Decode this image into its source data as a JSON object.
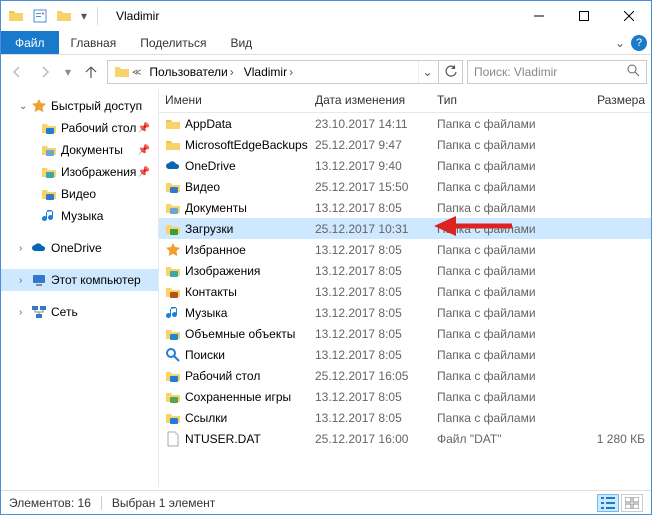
{
  "window": {
    "title": "Vladimir"
  },
  "ribbon": {
    "file": "Файл",
    "tabs": [
      "Главная",
      "Поделиться",
      "Вид"
    ]
  },
  "breadcrumb": {
    "segments": [
      "Пользователи",
      "Vladimir"
    ]
  },
  "search": {
    "placeholder": "Поиск: Vladimir"
  },
  "columns": {
    "name": "Имени",
    "date": "Дата изменения",
    "type": "Тип",
    "size": "Размера"
  },
  "nav": {
    "quick": "Быстрый доступ",
    "quick_items": [
      {
        "label": "Рабочий стол",
        "icon": "desktop",
        "pinned": true
      },
      {
        "label": "Документы",
        "icon": "docs",
        "pinned": true
      },
      {
        "label": "Изображения",
        "icon": "pics",
        "pinned": true
      },
      {
        "label": "Видео",
        "icon": "video",
        "pinned": false
      },
      {
        "label": "Музыка",
        "icon": "music",
        "pinned": false
      }
    ],
    "onedrive": "OneDrive",
    "thispc": "Этот компьютер",
    "network": "Сеть"
  },
  "files": [
    {
      "name": "AppData",
      "date": "23.10.2017 14:11",
      "type": "Папка с файлами",
      "size": "",
      "icon": "folder"
    },
    {
      "name": "MicrosoftEdgeBackups",
      "date": "25.12.2017 9:47",
      "type": "Папка с файлами",
      "size": "",
      "icon": "folder"
    },
    {
      "name": "OneDrive",
      "date": "13.12.2017 9:40",
      "type": "Папка с файлами",
      "size": "",
      "icon": "onedrive"
    },
    {
      "name": "Видео",
      "date": "25.12.2017 15:50",
      "type": "Папка с файлами",
      "size": "",
      "icon": "video"
    },
    {
      "name": "Документы",
      "date": "13.12.2017 8:05",
      "type": "Папка с файлами",
      "size": "",
      "icon": "docs"
    },
    {
      "name": "Загрузки",
      "date": "25.12.2017 10:31",
      "type": "Папка с файлами",
      "size": "",
      "icon": "downloads",
      "selected": true
    },
    {
      "name": "Избранное",
      "date": "13.12.2017 8:05",
      "type": "Папка с файлами",
      "size": "",
      "icon": "star"
    },
    {
      "name": "Изображения",
      "date": "13.12.2017 8:05",
      "type": "Папка с файлами",
      "size": "",
      "icon": "pics"
    },
    {
      "name": "Контакты",
      "date": "13.12.2017 8:05",
      "type": "Папка с файлами",
      "size": "",
      "icon": "contacts"
    },
    {
      "name": "Музыка",
      "date": "13.12.2017 8:05",
      "type": "Папка с файлами",
      "size": "",
      "icon": "music"
    },
    {
      "name": "Объемные объекты",
      "date": "13.12.2017 8:05",
      "type": "Папка с файлами",
      "size": "",
      "icon": "3d"
    },
    {
      "name": "Поиски",
      "date": "13.12.2017 8:05",
      "type": "Папка с файлами",
      "size": "",
      "icon": "search"
    },
    {
      "name": "Рабочий стол",
      "date": "25.12.2017 16:05",
      "type": "Папка с файлами",
      "size": "",
      "icon": "desktop"
    },
    {
      "name": "Сохраненные игры",
      "date": "13.12.2017 8:05",
      "type": "Папка с файлами",
      "size": "",
      "icon": "games"
    },
    {
      "name": "Ссылки",
      "date": "13.12.2017 8:05",
      "type": "Папка с файлами",
      "size": "",
      "icon": "links"
    },
    {
      "name": "NTUSER.DAT",
      "date": "25.12.2017 16:00",
      "type": "Файл \"DAT\"",
      "size": "1 280 КБ",
      "icon": "file"
    }
  ],
  "status": {
    "count": "Элементов: 16",
    "selection": "Выбран 1 элемент"
  },
  "icons": {
    "folder": "#f8d36a",
    "onedrive": "#0864b5",
    "video": "#3478c9",
    "docs": "#6aa7d0",
    "downloads": "#3b9e3b",
    "star": "#f0a030",
    "pics": "#3aa8a8",
    "contacts": "#b05520",
    "music": "#1e7fd6",
    "3d": "#2488cc",
    "search": "#1e7fd6",
    "desktop": "#1e7fd6",
    "games": "#53a553",
    "links": "#1e7fd6",
    "file": "#e0e0e0"
  }
}
